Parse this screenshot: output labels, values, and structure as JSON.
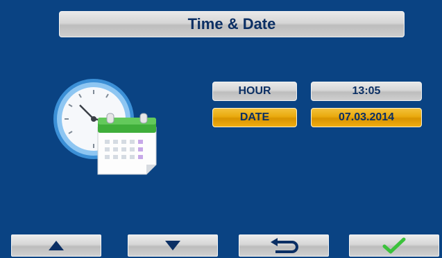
{
  "title": "Time & Date",
  "rows": [
    {
      "label": "HOUR",
      "value": "13:05"
    },
    {
      "label": "DATE",
      "value": "07.03.2014"
    }
  ],
  "selected_row": "DATE",
  "colors": {
    "background": "#0a4383",
    "selected": "#e9a90d",
    "text": "#0b2f64",
    "check": "#3cc23c"
  },
  "icons": {
    "illustration": [
      "clock-icon",
      "calendar-icon"
    ],
    "nav": [
      "triangle-up-icon",
      "triangle-down-icon",
      "return-arrow-icon",
      "checkmark-icon"
    ]
  }
}
